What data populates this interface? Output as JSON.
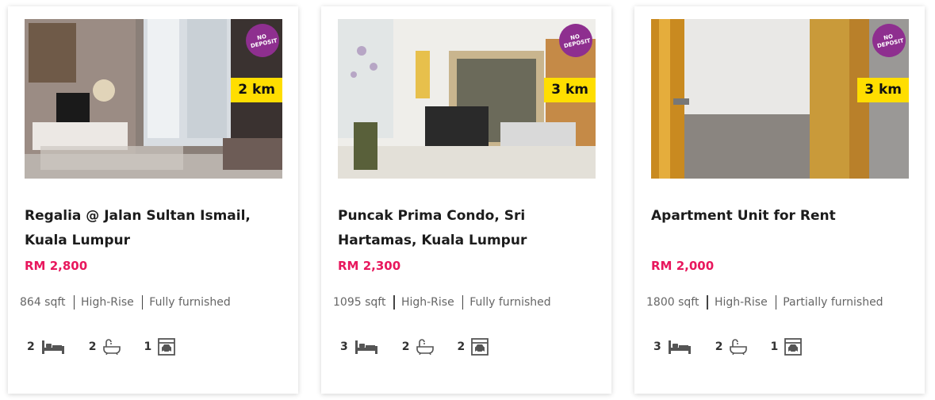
{
  "colors": {
    "price": "#e8175d",
    "km_badge": "#ffde00",
    "no_deposit_badge": "#8e2f8f"
  },
  "listings": [
    {
      "title": "Regalia @ Jalan Sultan Ismail, Kuala Lumpur",
      "price": "RM 2,800",
      "distance": "2 km",
      "badge": "NO DEPOSIT",
      "size": "864 sqft",
      "type": "High-Rise",
      "furnishing": "Fully furnished",
      "bedrooms": "2",
      "bathrooms": "2",
      "parking": "1",
      "photo_icon": "living-room-photo"
    },
    {
      "title": "Puncak Prima Condo, Sri Hartamas, Kuala Lumpur",
      "price": "RM 2,300",
      "distance": "3 km",
      "badge": "NO DEPOSIT",
      "size": "1095 sqft",
      "type": "High-Rise",
      "furnishing": "Fully furnished",
      "bedrooms": "3",
      "bathrooms": "2",
      "parking": "2",
      "photo_icon": "living-room-photo"
    },
    {
      "title": "Apartment Unit for Rent",
      "price": "RM 2,000",
      "distance": "3 km",
      "badge": "NO DEPOSIT",
      "size": "1800 sqft",
      "type": "High-Rise",
      "furnishing": "Partially furnished",
      "bedrooms": "3",
      "bathrooms": "2",
      "parking": "1",
      "photo_icon": "doorway-photo"
    }
  ],
  "icons": {
    "bed": "bed-icon",
    "bath": "bathtub-icon",
    "parking": "car-garage-icon"
  }
}
